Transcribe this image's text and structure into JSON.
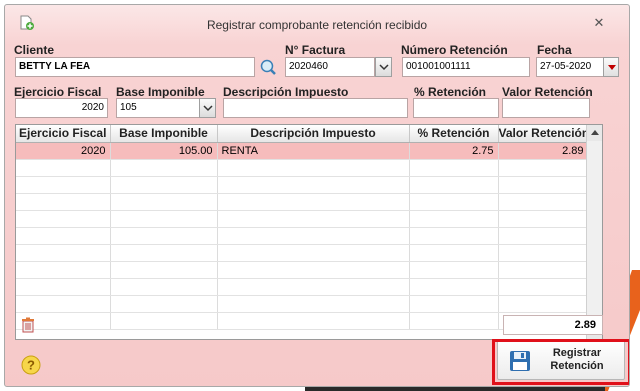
{
  "window": {
    "title": "Registrar comprobante retención recibido",
    "close_glyph": "✕"
  },
  "form": {
    "cliente": {
      "label": "Cliente",
      "value": "BETTY LA FEA"
    },
    "factura": {
      "label": "N° Factura",
      "value": "2020460"
    },
    "retencion": {
      "label": "Número Retención",
      "value": "001001001111"
    },
    "fecha": {
      "label": "Fecha",
      "value": "27-05-2020"
    },
    "ejercicio": {
      "label": "Ejercicio Fiscal",
      "value": "2020"
    },
    "base": {
      "label": "Base Imponible",
      "value": "105"
    },
    "descripcion": {
      "label": "Descripción Impuesto",
      "value": ""
    },
    "porcentaje": {
      "label": "% Retención",
      "value": ""
    },
    "valor": {
      "label": "Valor Retención",
      "value": ""
    }
  },
  "table": {
    "columns": [
      "Ejercicio Fiscal",
      "Base Imponible",
      "Descripción Impuesto",
      "% Retención",
      "Valor Retención"
    ],
    "rows": [
      {
        "ejercicio": "2020",
        "base": "105.00",
        "descripcion": "RENTA",
        "porcentaje": "2.75",
        "valor": "2.89"
      }
    ]
  },
  "total": "2.89",
  "buttons": {
    "registrar_line1": "Registrar",
    "registrar_line2": "Retención"
  },
  "icons": [
    "document-add-icon",
    "close-icon",
    "search-icon",
    "chevron-down-icon",
    "calendar-dropdown-icon",
    "delete-row-icon",
    "help-icon",
    "save-disk-icon"
  ],
  "colors": {
    "dialog_bg": "#f6c9c9",
    "selected_row": "#f6bcbc",
    "highlight_frame": "#e0101a",
    "deco_orange": "#e8621c"
  }
}
